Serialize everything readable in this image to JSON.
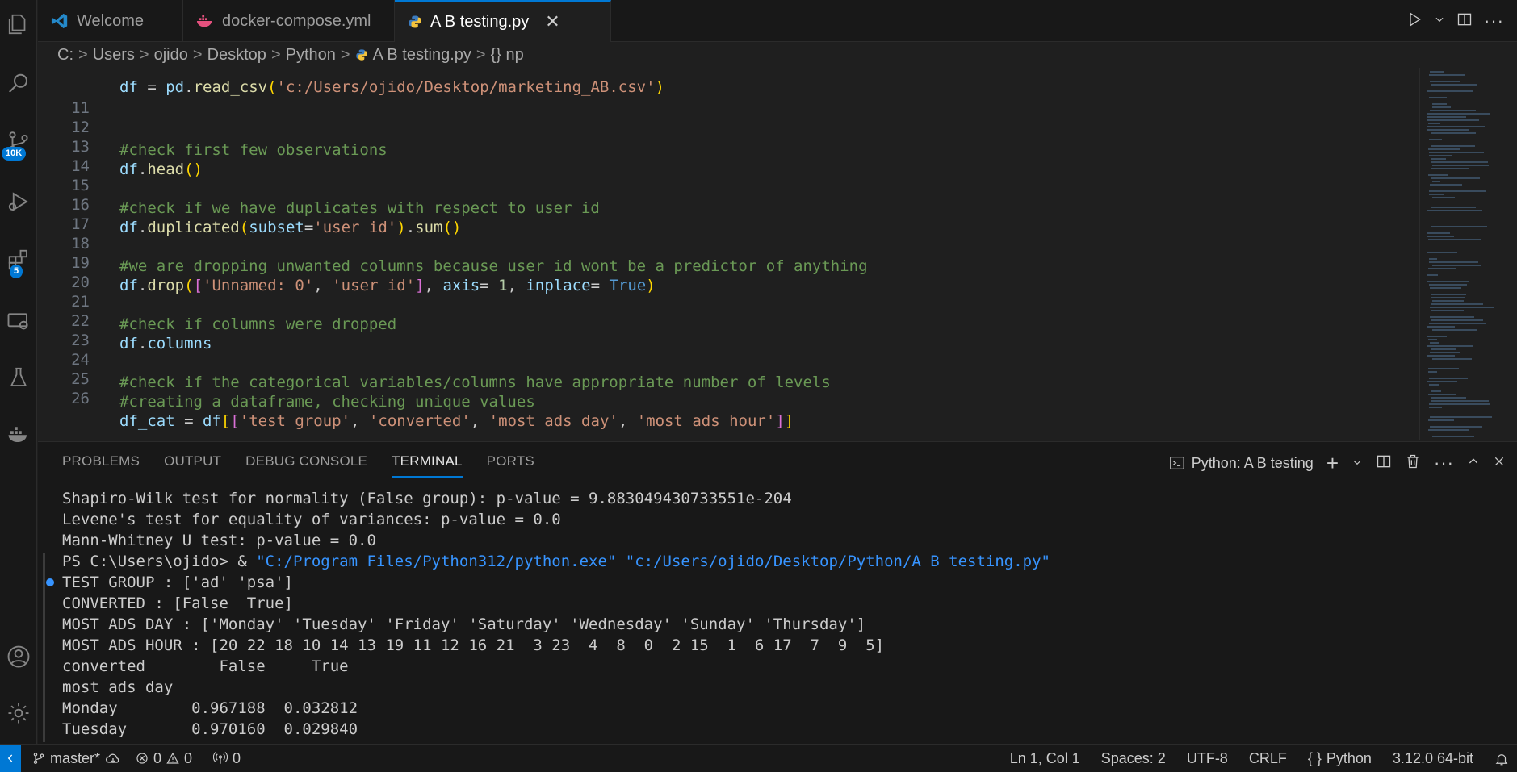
{
  "tabs": [
    {
      "label": "Welcome",
      "icon": "vscode-icon"
    },
    {
      "label": "docker-compose.yml",
      "icon": "docker-icon"
    },
    {
      "label": "A B testing.py",
      "icon": "python-icon",
      "close": "✕"
    }
  ],
  "breadcrumb": [
    "C:",
    "Users",
    "ojido",
    "Desktop",
    "Python",
    "A B testing.py",
    "{} np"
  ],
  "activity": {
    "source_control_badge": "10K",
    "extensions_badge": "5"
  },
  "editor": {
    "partial_line": "df = pd.read_csv('c:/Users/ojido/Desktop/marketing_AB.csv')",
    "lines": [
      {
        "n": "11",
        "text": ""
      },
      {
        "n": "12",
        "text": "#check first few observations"
      },
      {
        "n": "13",
        "text": "df.head()"
      },
      {
        "n": "14",
        "text": ""
      },
      {
        "n": "15",
        "text": "#check if we have duplicates with respect to user id"
      },
      {
        "n": "16",
        "text": "df.duplicated(subset='user id').sum()"
      },
      {
        "n": "17",
        "text": ""
      },
      {
        "n": "18",
        "text": "#we are dropping unwanted columns because user id wont be a predictor of anything"
      },
      {
        "n": "19",
        "text": "df.drop(['Unnamed: 0', 'user id'], axis= 1, inplace= True)"
      },
      {
        "n": "20",
        "text": ""
      },
      {
        "n": "21",
        "text": "#check if columns were dropped"
      },
      {
        "n": "22",
        "text": "df.columns"
      },
      {
        "n": "23",
        "text": ""
      },
      {
        "n": "24",
        "text": "#check if the categorical variables/columns have appropriate number of levels"
      },
      {
        "n": "25",
        "text": "#creating a dataframe, checking unique values"
      },
      {
        "n": "26",
        "text": "df_cat = df[['test group', 'converted', 'most ads day', 'most ads hour']]"
      }
    ]
  },
  "panel": {
    "tabs": [
      "PROBLEMS",
      "OUTPUT",
      "DEBUG CONSOLE",
      "TERMINAL",
      "PORTS"
    ],
    "active_tab": "TERMINAL",
    "terminal_name": "Python: A B testing",
    "terminal_lines": [
      "Shapiro-Wilk test for normality (False group): p-value = 9.883049430733551e-204",
      "Levene's test for equality of variances: p-value = 0.0",
      "Mann-Whitney U test: p-value = 0.0",
      "PS C:\\Users\\ojido> & ",
      "TEST GROUP : ['ad' 'psa']",
      "CONVERTED : [False  True]",
      "MOST ADS DAY : ['Monday' 'Tuesday' 'Friday' 'Saturday' 'Wednesday' 'Sunday' 'Thursday']",
      "MOST ADS HOUR : [20 22 18 10 14 13 19 11 12 16 21  3 23  4  8  0  2 15  1  6 17  7  9  5]",
      "converted        False     True",
      "most ads day",
      "Monday        0.967188  0.032812",
      "Tuesday       0.970160  0.029840"
    ],
    "cmd_exe": "\"C:/Program Files/Python312/python.exe\"",
    "cmd_file": "\"c:/Users/ojido/Desktop/Python/A B testing.py\""
  },
  "status": {
    "branch": "master*",
    "errors": "0",
    "warnings": "0",
    "ports": "0",
    "position": "Ln 1, Col 1",
    "spaces": "Spaces: 2",
    "encoding": "UTF-8",
    "eol": "CRLF",
    "language": "Python",
    "interpreter": "3.12.0 64-bit"
  }
}
